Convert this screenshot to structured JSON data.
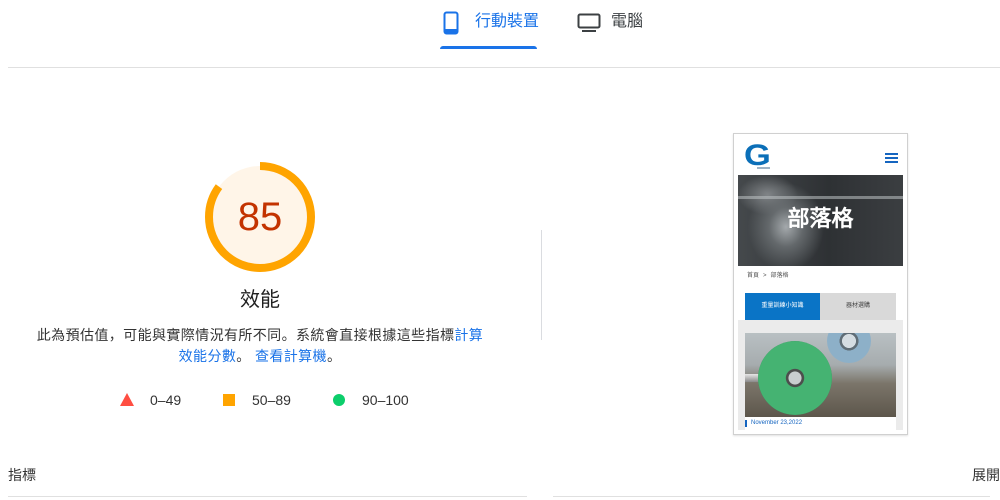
{
  "colors": {
    "accent": "#1a73e8"
  },
  "device_tabs": [
    {
      "label": "行動裝置",
      "icon": "smartphone-icon",
      "active": true
    },
    {
      "label": "電腦",
      "icon": "desktop-icon",
      "active": false
    }
  ],
  "score": {
    "value": 85,
    "label": "效能",
    "color": "#ffa400",
    "text_color": "#c33300",
    "bg_color": "#fff5e8"
  },
  "description": {
    "text": "此為預估值，可能與實際情況有所不同。系統會直接根據這些指標",
    "link1": "計算效能分數",
    "sep": "。",
    "link2": "查看計算機",
    "end": "。"
  },
  "legend": [
    {
      "range": "0–49",
      "icon": "triangle-icon",
      "color": "#ff4e42"
    },
    {
      "range": "50–89",
      "icon": "square-icon",
      "color": "#ffa400"
    },
    {
      "range": "90–100",
      "icon": "circle-icon",
      "color": "#0cce6b"
    }
  ],
  "preview": {
    "logo_text": "G",
    "hero_title": "部落格",
    "breadcrumb": [
      "首頁",
      ">",
      "部落格"
    ],
    "categories": [
      {
        "label": "重量訓練小知識",
        "active": true
      },
      {
        "label": "器材選購",
        "active": false
      }
    ],
    "post_date": "November 23,2022"
  },
  "metrics": {
    "title": "指標",
    "expand_label": "展開"
  }
}
